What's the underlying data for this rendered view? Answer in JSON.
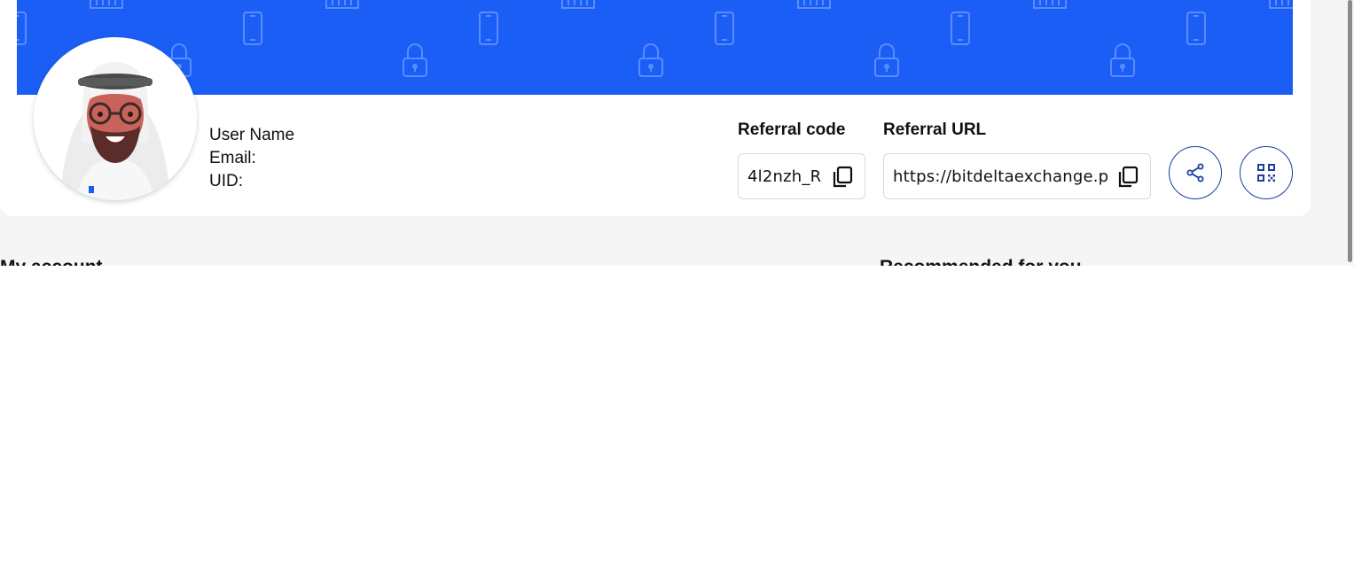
{
  "user": {
    "name_label": "User Name",
    "email_label": "Email:",
    "uid_label": "UID:"
  },
  "referral": {
    "code_label": "Referral code",
    "code_value": "4l2nzh_R",
    "url_label": "Referral URL",
    "url_value": "https://bitdeltaexchange.page"
  },
  "sections": {
    "left_heading": "My account",
    "right_heading": "Recommended for you"
  },
  "colors": {
    "banner": "#1a5ef5",
    "accent_outline": "#1a3f9c"
  },
  "icons": {
    "banner_pattern": [
      "lock-icon",
      "phone-icon",
      "keyboard-icon"
    ],
    "copy": "copy-icon",
    "share": "share-icon",
    "qr": "qr-code-icon"
  }
}
